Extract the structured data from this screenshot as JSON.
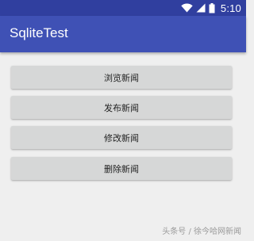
{
  "status_bar": {
    "time": "5:10",
    "icons": [
      "wifi-icon",
      "signal-icon",
      "battery-icon"
    ],
    "color": "#303f9f"
  },
  "app_bar": {
    "title": "SqliteTest",
    "color": "#3f51b5"
  },
  "buttons": [
    {
      "label": "浏览新闻"
    },
    {
      "label": "发布新闻"
    },
    {
      "label": "修改新闻"
    },
    {
      "label": "删除新闻"
    }
  ],
  "watermark": {
    "text": "头条号 / 徐今哈网新闻"
  }
}
